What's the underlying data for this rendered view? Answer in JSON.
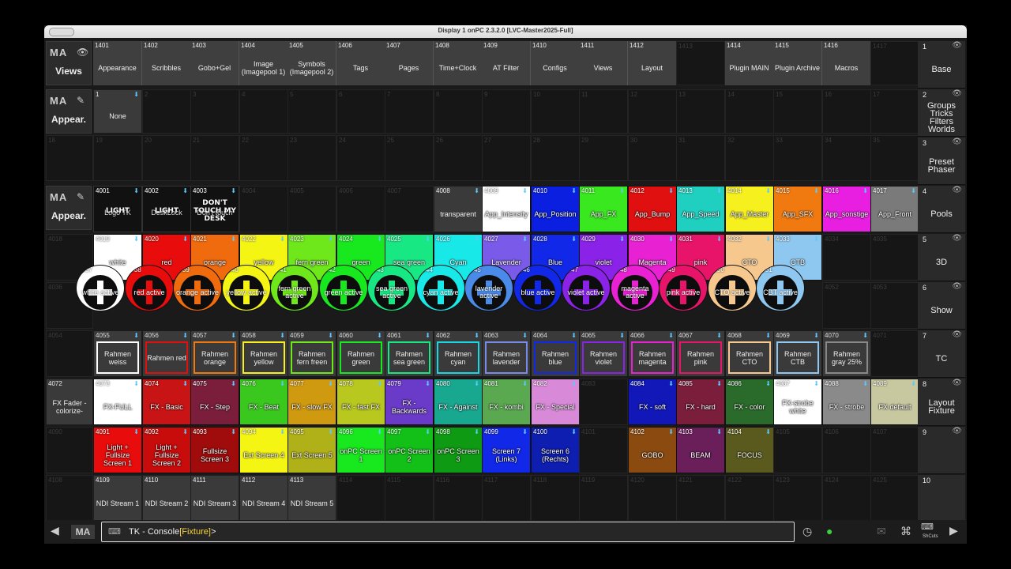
{
  "window": {
    "title": "Display 1 onPC 2.3.2.0 [LVC-Master2025-Full]"
  },
  "pools": [
    {
      "ma": "MA",
      "title": "Views",
      "icon": "eye-icon"
    },
    {
      "ma": "MA",
      "title": "Appear.",
      "icon": "edit-icon"
    },
    {
      "ma": "MA",
      "title": "Appear.",
      "icon": "edit-icon"
    }
  ],
  "views_row": [
    {
      "n": "1401",
      "l": "Appearance"
    },
    {
      "n": "1402",
      "l": "Scribbles"
    },
    {
      "n": "1403",
      "l": "Gobo+Gel"
    },
    {
      "n": "1404",
      "l": "Image (Imagepool 1)"
    },
    {
      "n": "1405",
      "l": "Symbols (Imagepool 2)"
    },
    {
      "n": "1406",
      "l": "Tags"
    },
    {
      "n": "1407",
      "l": "Pages"
    },
    {
      "n": "1408",
      "l": "Time+Clock"
    },
    {
      "n": "1409",
      "l": "AT Filter"
    },
    {
      "n": "1410",
      "l": "Configs"
    },
    {
      "n": "1411",
      "l": "Views"
    },
    {
      "n": "1412",
      "l": "Layout"
    },
    {
      "n": "1413",
      "l": ""
    },
    {
      "n": "1414",
      "l": "Plugin MAIN"
    },
    {
      "n": "1415",
      "l": "Plugin Archive"
    },
    {
      "n": "1416",
      "l": "Macros"
    },
    {
      "n": "1417",
      "l": ""
    }
  ],
  "appear1": {
    "first": {
      "n": "1",
      "l": "None"
    },
    "row2_start": 18
  },
  "rows": [
    [
      {
        "n": "4001",
        "l": "Logo TK",
        "t": "logo",
        "c": "#111111",
        "logo": "LIGHT"
      },
      {
        "n": "4002",
        "l": "DeskLock",
        "t": "logo",
        "c": "#111111",
        "logo": "LIGHT"
      },
      {
        "n": "4003",
        "l": "Don't touch",
        "t": "logo",
        "c": "#111111",
        "logo": "DON'T TOUCH MY DESK"
      },
      {
        "n": "4004",
        "t": "empty"
      },
      {
        "n": "4005",
        "t": "empty"
      },
      {
        "n": "4006",
        "t": "empty"
      },
      {
        "n": "4007",
        "t": "empty"
      },
      {
        "n": "4008",
        "l": "transparent",
        "t": "plain"
      },
      {
        "n": "4009",
        "l": "App_Intensity",
        "c": "#ffffff",
        "tc": "#ffffff"
      },
      {
        "n": "4010",
        "l": "App_Position",
        "c": "#0a1fe0",
        "tc": "#ffffff"
      },
      {
        "n": "4011",
        "l": "App_FX",
        "c": "#39e81e",
        "tc": "#ffffff"
      },
      {
        "n": "4012",
        "l": "App_Bump",
        "c": "#e01010",
        "tc": "#ffffff"
      },
      {
        "n": "4013",
        "l": "App_Speed",
        "c": "#1fd0c0",
        "tc": "#ffffff"
      },
      {
        "n": "4014",
        "l": "App_Master",
        "c": "#f5f01e",
        "tc": "#ffffff"
      },
      {
        "n": "4015",
        "l": "App_SFX",
        "c": "#f07a10",
        "tc": "#ffffff"
      },
      {
        "n": "4016",
        "l": "App_sonstige",
        "c": "#e81ee0",
        "tc": "#ffffff"
      },
      {
        "n": "4017",
        "l": "App_Front",
        "c": "#7a7a7a",
        "tc": "#ffffff"
      }
    ],
    [
      {
        "n": "4018",
        "t": "empty"
      },
      {
        "n": "4019",
        "l": "white",
        "c": "#ffffff",
        "tc": "#ffffff"
      },
      {
        "n": "4020",
        "l": "red",
        "c": "#e80c0c",
        "tc": "#ffffff"
      },
      {
        "n": "4021",
        "l": "orange",
        "c": "#f06a0e",
        "tc": "#ffffff"
      },
      {
        "n": "4022",
        "l": "yellow",
        "c": "#f5f514",
        "tc": "#ffffff"
      },
      {
        "n": "4023",
        "l": "fern green",
        "c": "#6ee81a",
        "tc": "#ffffff"
      },
      {
        "n": "4024",
        "l": "green",
        "c": "#18e81e",
        "tc": "#ffffff"
      },
      {
        "n": "4025",
        "l": "sea green",
        "c": "#18e884",
        "tc": "#ffffff"
      },
      {
        "n": "4026",
        "l": "Cyan",
        "c": "#18e8e8",
        "tc": "#ffffff"
      },
      {
        "n": "4027",
        "l": "Lavender",
        "c": "#7a5ae8",
        "tc": "#ffffff"
      },
      {
        "n": "4028",
        "l": "Blue",
        "c": "#1228e8",
        "tc": "#ffffff"
      },
      {
        "n": "4029",
        "l": "violet",
        "c": "#8a22e8",
        "tc": "#ffffff"
      },
      {
        "n": "4030",
        "l": "Magenta",
        "c": "#e822d2",
        "tc": "#ffffff"
      },
      {
        "n": "4031",
        "l": "pink",
        "c": "#e8146a",
        "tc": "#ffffff"
      },
      {
        "n": "4032",
        "l": "CTO",
        "c": "#f6c88e",
        "tc": "#ffffff"
      },
      {
        "n": "4033",
        "l": "CTB",
        "c": "#8ec8f0",
        "tc": "#ffffff"
      },
      {
        "n": "4034",
        "t": "empty"
      },
      {
        "n": "4035",
        "t": "empty"
      }
    ],
    [
      {
        "n": "4036",
        "t": "empty"
      },
      {
        "n": "4037",
        "l": "white active",
        "c": "#ffffff",
        "t": "circ"
      },
      {
        "n": "4038",
        "l": "red active",
        "c": "#e80c0c",
        "t": "circ"
      },
      {
        "n": "4039",
        "l": "orange active",
        "c": "#f06a0e",
        "t": "circ"
      },
      {
        "n": "4040",
        "l": "yellow active",
        "c": "#f5f514",
        "t": "circ"
      },
      {
        "n": "4041",
        "l": "fern green active",
        "c": "#6ee81a",
        "t": "circ"
      },
      {
        "n": "4042",
        "l": "green active",
        "c": "#18e81e",
        "t": "circ"
      },
      {
        "n": "4043",
        "l": "sea green active",
        "c": "#18e884",
        "t": "circ"
      },
      {
        "n": "4044",
        "l": "cyan active",
        "c": "#18e8e8",
        "t": "circ"
      },
      {
        "n": "4045",
        "l": "lavender active",
        "c": "#4a8ae8",
        "t": "circ"
      },
      {
        "n": "4046",
        "l": "blue active",
        "c": "#1228e8",
        "t": "circ"
      },
      {
        "n": "4047",
        "l": "violet active",
        "c": "#8a22e8",
        "t": "circ"
      },
      {
        "n": "4048",
        "l": "magenta active",
        "c": "#e822d2",
        "t": "circ"
      },
      {
        "n": "4049",
        "l": "pink active",
        "c": "#e8146a",
        "t": "circ"
      },
      {
        "n": "4050",
        "l": "CTO active",
        "c": "#f6c88e",
        "t": "circ"
      },
      {
        "n": "4051",
        "l": "CBT active",
        "c": "#8ec8f0",
        "t": "circ"
      },
      {
        "n": "4052",
        "t": "empty"
      },
      {
        "n": "4053",
        "t": "empty"
      }
    ],
    [
      {
        "n": "4054",
        "t": "empty"
      },
      {
        "n": "4055",
        "l": "Rahmen weiss",
        "c": "#ffffff",
        "t": "rahmen"
      },
      {
        "n": "4056",
        "l": "Rahmen red",
        "c": "#e01010",
        "t": "rahmen"
      },
      {
        "n": "4057",
        "l": "Rahmen orange",
        "c": "#f07a10",
        "t": "rahmen"
      },
      {
        "n": "4058",
        "l": "Rahmen yellow",
        "c": "#f5f01e",
        "t": "rahmen"
      },
      {
        "n": "4059",
        "l": "Rahmen fern freen",
        "c": "#6ee81a",
        "t": "rahmen"
      },
      {
        "n": "4060",
        "l": "Rahmen green",
        "c": "#18e81e",
        "t": "rahmen"
      },
      {
        "n": "4061",
        "l": "Rahmen sea green",
        "c": "#18e884",
        "t": "rahmen"
      },
      {
        "n": "4062",
        "l": "Rahmen cyan",
        "c": "#18d8e8",
        "t": "rahmen"
      },
      {
        "n": "4063",
        "l": "Rahmen lavender",
        "c": "#7a8ae8",
        "t": "rahmen"
      },
      {
        "n": "4064",
        "l": "Rahmen blue",
        "c": "#1228e8",
        "t": "rahmen"
      },
      {
        "n": "4065",
        "l": "Rahmen violet",
        "c": "#8a22e8",
        "t": "rahmen"
      },
      {
        "n": "4066",
        "l": "Rahmen magenta",
        "c": "#e822d2",
        "t": "rahmen"
      },
      {
        "n": "4067",
        "l": "Rahmen pink",
        "c": "#e8146a",
        "t": "rahmen"
      },
      {
        "n": "4068",
        "l": "Rahmen CTO",
        "c": "#f6c88e",
        "t": "rahmen"
      },
      {
        "n": "4069",
        "l": "Rahmen CTB",
        "c": "#8ec8f0",
        "t": "rahmen"
      },
      {
        "n": "4070",
        "l": "Rahmen gray 25%",
        "c": "#888888",
        "t": "rahmen"
      },
      {
        "n": "4071",
        "t": "empty"
      }
    ],
    [
      {
        "n": "4072",
        "l": "FX Fader -colorize-",
        "t": "plain"
      },
      {
        "n": "4073",
        "l": "FX-FULL",
        "c": "#ffffff",
        "tc": "#ffffff"
      },
      {
        "n": "4074",
        "l": "FX - Basic",
        "c": "#c81414",
        "tc": "#ffffff"
      },
      {
        "n": "4075",
        "l": "FX - Step",
        "c": "#7a1e3c",
        "tc": "#ffffff"
      },
      {
        "n": "4076",
        "l": "FX - Beat",
        "c": "#3ac81e",
        "tc": "#ffffff"
      },
      {
        "n": "4077",
        "l": "FX - slow FX",
        "c": "#d09a10",
        "tc": "#ffffff"
      },
      {
        "n": "4078",
        "l": "FX - fast FX",
        "c": "#b8c81e",
        "tc": "#ffffff"
      },
      {
        "n": "4079",
        "l": "FX - Backwards",
        "c": "#6a3ac8",
        "tc": "#ffffff"
      },
      {
        "n": "4080",
        "l": "FX - Against",
        "c": "#18a890",
        "tc": "#ffffff"
      },
      {
        "n": "4081",
        "l": "FX - kombi",
        "c": "#5aa850",
        "tc": "#ffffff"
      },
      {
        "n": "4082",
        "l": "FX - Special",
        "c": "#d88ad8",
        "tc": "#ffffff"
      },
      {
        "n": "4083",
        "t": "empty"
      },
      {
        "n": "4084",
        "l": "FX - soft",
        "c": "#1218b8",
        "tc": "#ffffff"
      },
      {
        "n": "4085",
        "l": "FX - hard",
        "c": "#7a1e3c",
        "tc": "#ffffff"
      },
      {
        "n": "4086",
        "l": "FX - color",
        "c": "#2a6a2a",
        "tc": "#ffffff"
      },
      {
        "n": "4087",
        "l": "FX-strobe white",
        "c": "#ffffff",
        "tc": "#ffffff"
      },
      {
        "n": "4088",
        "l": "FX - strobe",
        "c": "#8a8a8a",
        "tc": "#ffffff"
      },
      {
        "n": "4089",
        "l": "FX default",
        "c": "#c8c8a0",
        "tc": "#ffffff"
      }
    ],
    [
      {
        "n": "4090",
        "t": "empty"
      },
      {
        "n": "4091",
        "l": "Light + Fullsize Screen 1",
        "c": "#e80c0c",
        "tc": "#ffffff"
      },
      {
        "n": "4092",
        "l": "Light + Fullsize Screen 2",
        "c": "#c80c0c",
        "tc": "#ffffff"
      },
      {
        "n": "4093",
        "l": "Fullsize Screen 3",
        "c": "#a00c0c",
        "tc": "#ffffff"
      },
      {
        "n": "4094",
        "l": "Ext Screen 4",
        "c": "#f5f514",
        "tc": "#ffffff"
      },
      {
        "n": "4095",
        "l": "Ext Screen 5",
        "c": "#b0b018",
        "tc": "#ffffff"
      },
      {
        "n": "4096",
        "l": "onPC Screen 1",
        "c": "#18e81e",
        "tc": "#ffffff"
      },
      {
        "n": "4097",
        "l": "onPC Screen 2",
        "c": "#12c018",
        "tc": "#ffffff"
      },
      {
        "n": "4098",
        "l": "onPC Screen 3",
        "c": "#0e9a12",
        "tc": "#ffffff"
      },
      {
        "n": "4099",
        "l": "Screen 7 (Links)",
        "c": "#1228e8",
        "tc": "#ffffff"
      },
      {
        "n": "4100",
        "l": "Screen 6 (Rechts)",
        "c": "#0e1eb0",
        "tc": "#ffffff"
      },
      {
        "n": "4101",
        "t": "empty"
      },
      {
        "n": "4102",
        "l": "GOBO",
        "c": "#8a4a10",
        "tc": "#ffffff"
      },
      {
        "n": "4103",
        "l": "BEAM",
        "c": "#6a1e5a",
        "tc": "#ffffff"
      },
      {
        "n": "4104",
        "l": "FOCUS",
        "c": "#5a5a1e",
        "tc": "#ffffff"
      },
      {
        "n": "4105",
        "t": "empty"
      },
      {
        "n": "4106",
        "t": "empty"
      },
      {
        "n": "4107",
        "t": "empty"
      }
    ],
    [
      {
        "n": "4108",
        "t": "empty"
      },
      {
        "n": "4109",
        "l": "NDI Stream 1",
        "t": "plain"
      },
      {
        "n": "4110",
        "l": "NDI Stream 2",
        "t": "plain"
      },
      {
        "n": "4111",
        "l": "NDI Stream 3",
        "t": "plain"
      },
      {
        "n": "4112",
        "l": "NDI Stream 4",
        "t": "plain"
      },
      {
        "n": "4113",
        "l": "NDI Stream 5",
        "t": "plain"
      },
      {
        "n": "4114",
        "t": "empty"
      },
      {
        "n": "4115",
        "t": "empty"
      },
      {
        "n": "4116",
        "t": "empty"
      },
      {
        "n": "4117",
        "t": "empty"
      },
      {
        "n": "4118",
        "t": "empty"
      },
      {
        "n": "4119",
        "t": "empty"
      },
      {
        "n": "4120",
        "t": "empty"
      },
      {
        "n": "4121",
        "t": "empty"
      },
      {
        "n": "4122",
        "t": "empty"
      },
      {
        "n": "4123",
        "t": "empty"
      },
      {
        "n": "4124",
        "t": "empty"
      },
      {
        "n": "4125",
        "t": "empty"
      }
    ]
  ],
  "sidebar": [
    {
      "n": "1",
      "l": "Base"
    },
    {
      "n": "2",
      "l": "Groups Tricks Filters Worlds"
    },
    {
      "n": "3",
      "l": "Preset Phaser"
    },
    {
      "n": "4",
      "l": "Pools"
    },
    {
      "n": "5",
      "l": "3D"
    },
    {
      "n": "6",
      "l": "Show"
    },
    {
      "n": "7",
      "l": "TC"
    },
    {
      "n": "8",
      "l": "Layout Fixture"
    },
    {
      "n": "9",
      "l": ""
    },
    {
      "n": "10",
      "l": ""
    }
  ],
  "commandline": {
    "prefix": "TK - Console",
    "bracket": "[Fixture]",
    "suffix": ">"
  },
  "bottom": {
    "ma": "MA",
    "shortcuts": "ShCuts"
  }
}
